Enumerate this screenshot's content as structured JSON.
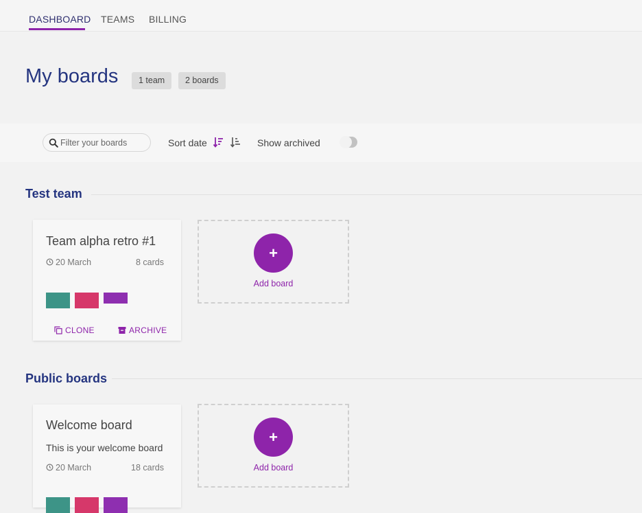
{
  "nav": {
    "tabs": [
      {
        "label": "DASHBOARD",
        "active": true
      },
      {
        "label": "TEAMS",
        "active": false
      },
      {
        "label": "BILLING",
        "active": false
      }
    ]
  },
  "header": {
    "title": "My boards",
    "badges": [
      "1 team",
      "2 boards"
    ]
  },
  "toolbar": {
    "search_placeholder": "Filter your boards",
    "sort_label": "Sort date",
    "sort_icons": [
      "sort-descending-icon",
      "sort-ascending-icon"
    ],
    "archived_label": "Show archived",
    "archived_on": false
  },
  "sections": [
    {
      "title": "Test team",
      "boards": [
        {
          "name": "Team alpha retro #1",
          "description": "",
          "date": "20 March",
          "cards": "8 cards",
          "colors": [
            "#3d9487",
            "#d6386a",
            "#8e2fb0"
          ],
          "actions": [
            "CLONE",
            "ARCHIVE"
          ]
        }
      ],
      "add_label": "Add board"
    },
    {
      "title": "Public boards",
      "boards": [
        {
          "name": "Welcome board",
          "description": "This is your welcome board",
          "date": "20 March",
          "cards": "18 cards",
          "colors": [
            "#3d9487",
            "#d6386a",
            "#8e2fb0"
          ]
        }
      ],
      "add_label": "Add board"
    }
  ],
  "colors": {
    "accent": "#8e24aa",
    "title": "#253580"
  }
}
